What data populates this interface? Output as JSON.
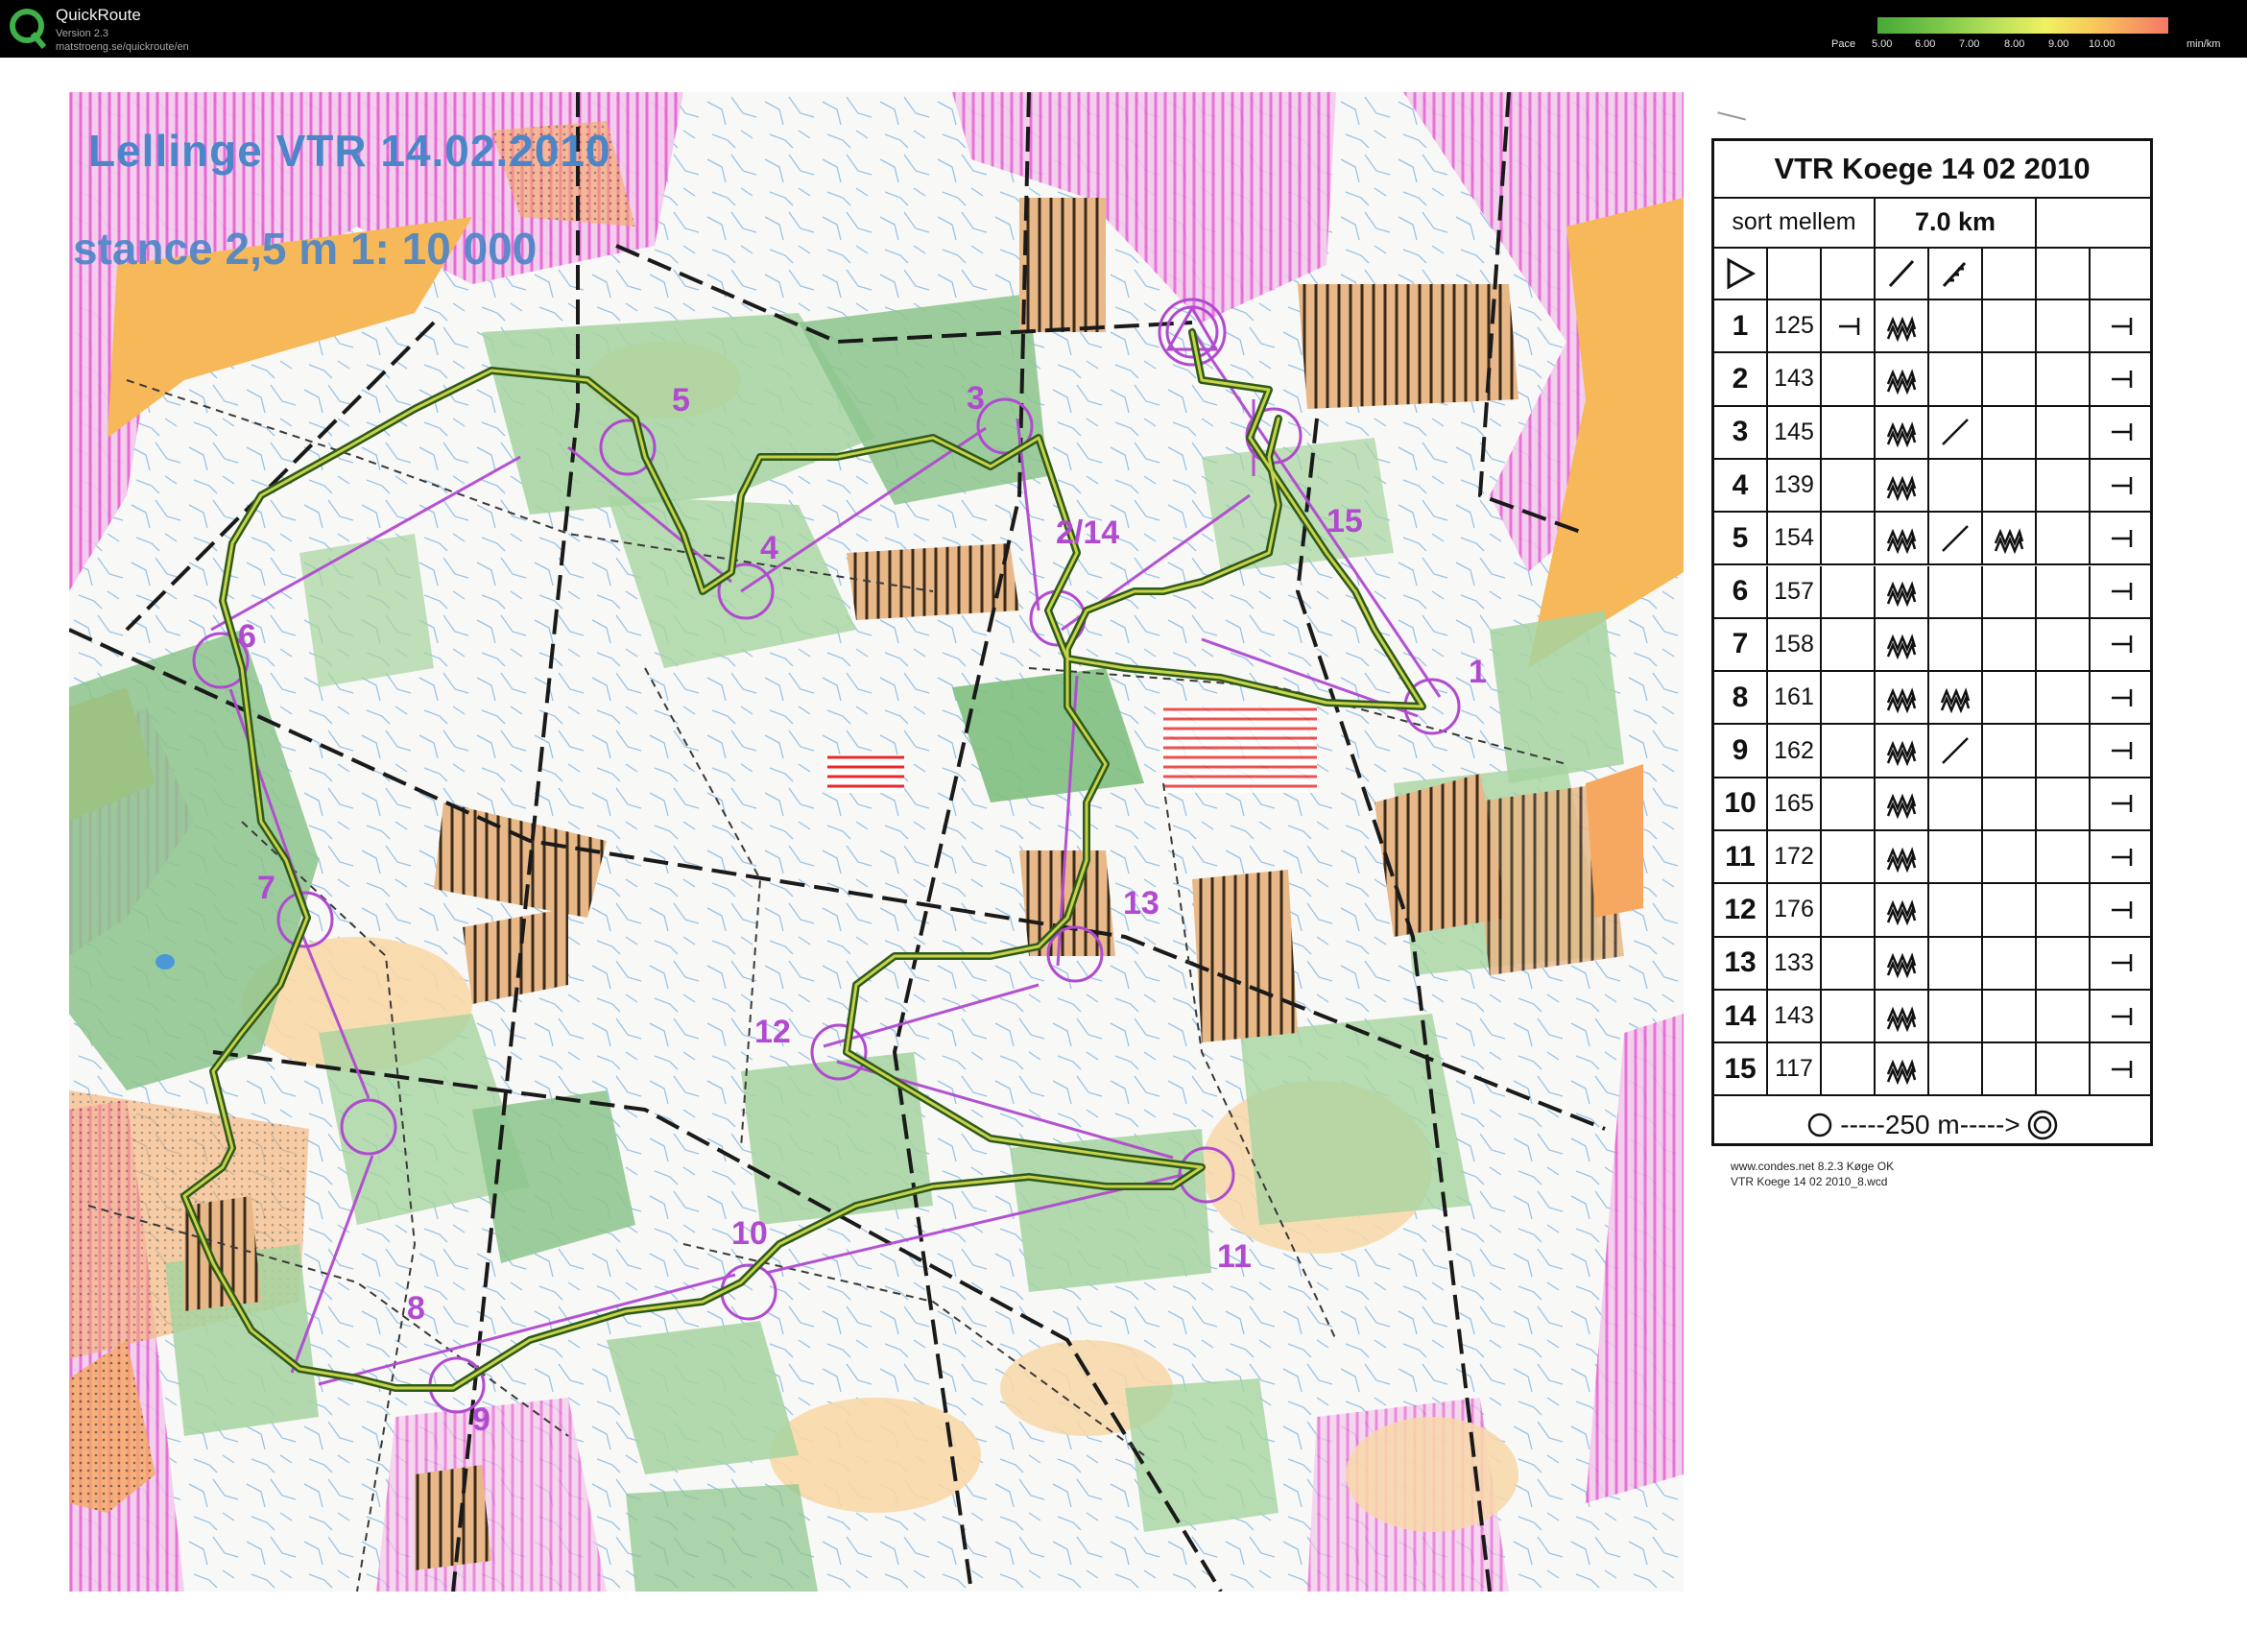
{
  "app": {
    "name": "QuickRoute",
    "version": "Version 2.3",
    "url": "matstroeng.se/quickroute/en"
  },
  "pace_legend": {
    "label": "Pace",
    "ticks": [
      "5.00",
      "6.00",
      "7.00",
      "8.00",
      "9.00",
      "10.00"
    ],
    "unit": "min/km",
    "colors": [
      "#48a838",
      "#b8e05a",
      "#f0f062",
      "#f8c45a",
      "#f47868"
    ]
  },
  "map": {
    "title": "Lellinge  VTR  14.02.2010",
    "scale_line": "stance  2,5 m      1: 10 000",
    "controls": [
      "1",
      "2/14",
      "3",
      "4",
      "5",
      "6",
      "7",
      "8",
      "9",
      "10",
      "11",
      "12",
      "13",
      "15"
    ],
    "colors": {
      "forest_green": "#8cc48c",
      "open_land": "#f6b858",
      "rough_open": "#f8d8a8",
      "out_of_bounds": "#e85ad0",
      "course_purple": "#b04ad0",
      "route_green": "#2e5a1a",
      "water": "#4a98d8"
    }
  },
  "description_sheet": {
    "title": "VTR Koege 14 02 2010",
    "class": "sort mellem",
    "length": "7.0 km",
    "controls": [
      {
        "n": "1",
        "code": "125"
      },
      {
        "n": "2",
        "code": "143"
      },
      {
        "n": "3",
        "code": "145"
      },
      {
        "n": "4",
        "code": "139"
      },
      {
        "n": "5",
        "code": "154"
      },
      {
        "n": "6",
        "code": "157"
      },
      {
        "n": "7",
        "code": "158"
      },
      {
        "n": "8",
        "code": "161"
      },
      {
        "n": "9",
        "code": "162"
      },
      {
        "n": "10",
        "code": "165"
      },
      {
        "n": "11",
        "code": "172"
      },
      {
        "n": "12",
        "code": "176"
      },
      {
        "n": "13",
        "code": "133"
      },
      {
        "n": "14",
        "code": "143"
      },
      {
        "n": "15",
        "code": "117"
      }
    ],
    "finish": "-----250 m----->",
    "footer_line1": "www.condes.net 8.2.3 Køge OK",
    "footer_line2": "VTR Koege 14 02 2010_8.wcd"
  }
}
